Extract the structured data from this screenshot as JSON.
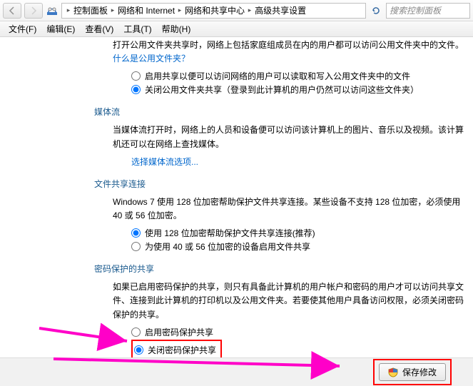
{
  "breadcrumbs": {
    "b1": "控制面板",
    "b2": "网络和 Internet",
    "b3": "网络和共享中心",
    "b4": "高级共享设置"
  },
  "search": {
    "placeholder": "搜索控制面板"
  },
  "menu": {
    "file": "文件(F)",
    "edit": "编辑(E)",
    "view": "查看(V)",
    "tools": "工具(T)",
    "help": "帮助(H)"
  },
  "intro_line": "打开公用文件夹共享时，网络上包括家庭组成员在内的用户都可以访问公用文件夹中的文件。",
  "intro_link": "什么是公用文件夹？",
  "public_folder": {
    "opt_on": "启用共享以便可以访问网络的用户可以读取和写入公用文件夹中的文件",
    "opt_off": "关闭公用文件夹共享（登录到此计算机的用户仍然可以访问这些文件夹）"
  },
  "media": {
    "title": "媒体流",
    "desc": "当媒体流打开时，网络上的人员和设备便可以访问该计算机上的图片、音乐以及视频。该计算机还可以在网络上查找媒体。",
    "link": "选择媒体流选项..."
  },
  "file_conn": {
    "title": "文件共享连接",
    "desc": "Windows 7 使用 128 位加密帮助保护文件共享连接。某些设备不支持 128 位加密，必须使用 40 或 56 位加密。",
    "opt1": "使用 128 位加密帮助保护文件共享连接(推荐)",
    "opt2": "为使用 40 或 56 位加密的设备启用文件共享"
  },
  "password": {
    "title": "密码保护的共享",
    "desc": "如果已启用密码保护的共享，则只有具备此计算机的用户帐户和密码的用户才可以访问共享文件、连接到此计算机的打印机以及公用文件夹。若要使其他用户具备访问权限，必须关闭密码保护的共享。",
    "opt_on": "启用密码保护共享",
    "opt_off": "关闭密码保护共享"
  },
  "buttons": {
    "save": "保存修改"
  }
}
